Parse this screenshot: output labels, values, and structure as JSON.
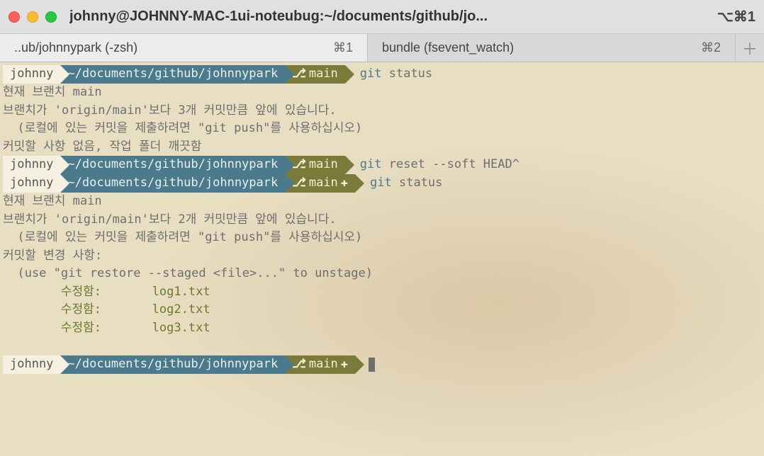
{
  "window": {
    "title": "johnny@JOHNNY-MAC-1ui-noteubug:~/documents/github/jo...",
    "shortcut": "⌥⌘1"
  },
  "tabs": [
    {
      "label": "..ub/johnnypark (-zsh)",
      "key": "⌘1",
      "active": true
    },
    {
      "label": "bundle (fsevent_watch)",
      "key": "⌘2",
      "active": false
    }
  ],
  "colors": {
    "teal": "#4a7a8c",
    "olive": "#7a7a3a",
    "bg": "#e8dec2"
  },
  "prompt": {
    "user": "johnny",
    "path": "~/documents/github/johnnypark",
    "branch_glyph": "⎇",
    "branch": "main",
    "dirty_glyph": "✚"
  },
  "blocks": [
    {
      "cmd": {
        "git": "git",
        "rest": " status"
      },
      "dirty": false
    },
    {
      "cmd": {
        "git": "git",
        "rest": " reset --soft HEAD^"
      },
      "dirty": false
    },
    {
      "cmd": {
        "git": "git",
        "rest": " status"
      },
      "dirty": true
    }
  ],
  "out1": {
    "l1": "현재 브랜치 main",
    "l2": "브랜치가 'origin/main'보다 3개 커밋만큼 앞에 있습니다.",
    "l3": "  (로컬에 있는 커밋을 제출하려면 \"git push\"를 사용하십시오)",
    "l4": "",
    "l5": "커밋할 사항 없음, 작업 폴더 깨끗함"
  },
  "out2": {
    "l1": "현재 브랜치 main",
    "l2": "브랜치가 'origin/main'보다 2개 커밋만큼 앞에 있습니다.",
    "l3": "  (로컬에 있는 커밋을 제출하려면 \"git push\"를 사용하십시오)",
    "l4": "",
    "l5": "커밋할 변경 사항:",
    "l6": "  (use \"git restore --staged <file>...\" to unstage)",
    "staged": [
      "        수정함:       log1.txt",
      "        수정함:       log2.txt",
      "        수정함:       log3.txt"
    ]
  }
}
